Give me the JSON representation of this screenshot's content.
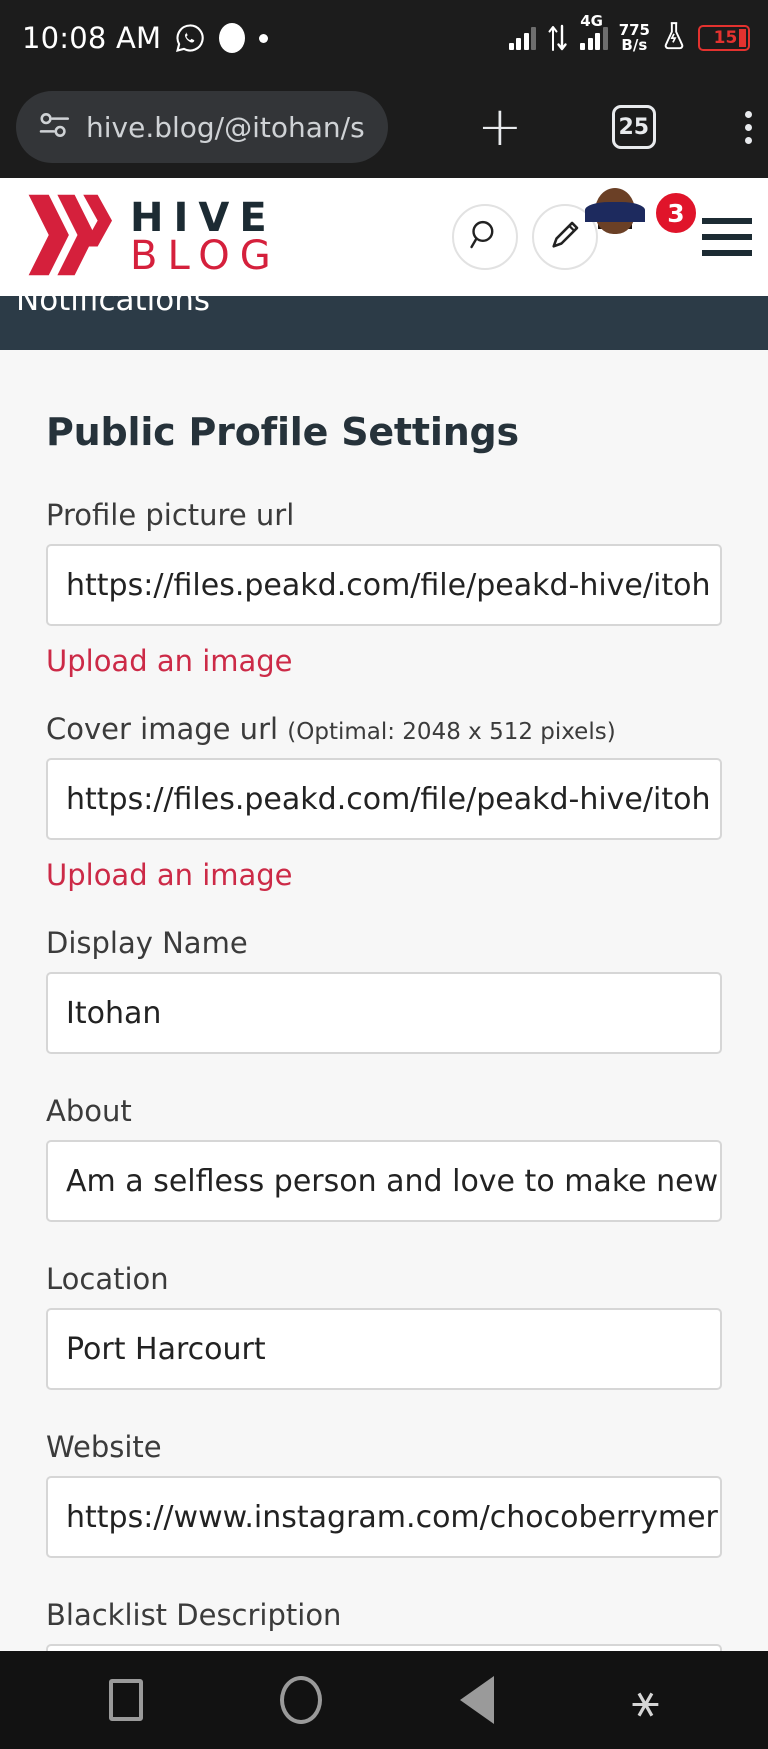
{
  "status_bar": {
    "clock": "10:08 AM",
    "icons": [
      "whatsapp-icon",
      "recording-dot-icon",
      "small-dot-icon"
    ],
    "network_type": "4G",
    "data_speed_value": "775",
    "data_speed_unit": "B/s",
    "battery_percent": "15",
    "battery_color": "#e3322f"
  },
  "browser": {
    "url": "hive.blog/@itohan/setting",
    "tab_count": "25",
    "new_tab_label": "+",
    "menu_label": "⋮"
  },
  "site_header": {
    "logo_primary": "HIVE",
    "logo_secondary": "BLOG",
    "logo_color": "#d5203c",
    "search_icon": "search-icon",
    "compose_icon": "pencil-icon",
    "notification_count": "3",
    "notification_badge_color": "#e0142a"
  },
  "nav_strip": {
    "active_item": "Notifications",
    "background": "#2c3b47"
  },
  "main": {
    "page_title": "Public Profile Settings",
    "upload_link_label": "Upload an image",
    "accent_link_color": "#cc2a47",
    "fields": [
      {
        "label": "Profile picture url",
        "hint": "",
        "value": "https://files.peakd.com/file/peakd-hive/itoh",
        "has_upload_link": true
      },
      {
        "label": "Cover image url",
        "hint": "(Optimal: 2048 x 512 pixels)",
        "value": "https://files.peakd.com/file/peakd-hive/itoh",
        "has_upload_link": true
      },
      {
        "label": "Display Name",
        "hint": "",
        "value": "Itohan",
        "has_upload_link": false
      },
      {
        "label": "About",
        "hint": "",
        "value": "Am a selfless person and love to make new fr",
        "has_upload_link": false
      },
      {
        "label": "Location",
        "hint": "",
        "value": "Port Harcourt",
        "has_upload_link": false
      },
      {
        "label": "Website",
        "hint": "",
        "value": "https://www.instagram.com/chocoberrymer",
        "has_upload_link": false
      },
      {
        "label": "Blacklist Description",
        "hint": "",
        "value": "",
        "has_upload_link": false
      }
    ]
  },
  "android_nav": {
    "recents": "square-icon",
    "home": "circle-icon",
    "back": "triangle-back-icon",
    "accessibility": "accessibility-icon"
  }
}
